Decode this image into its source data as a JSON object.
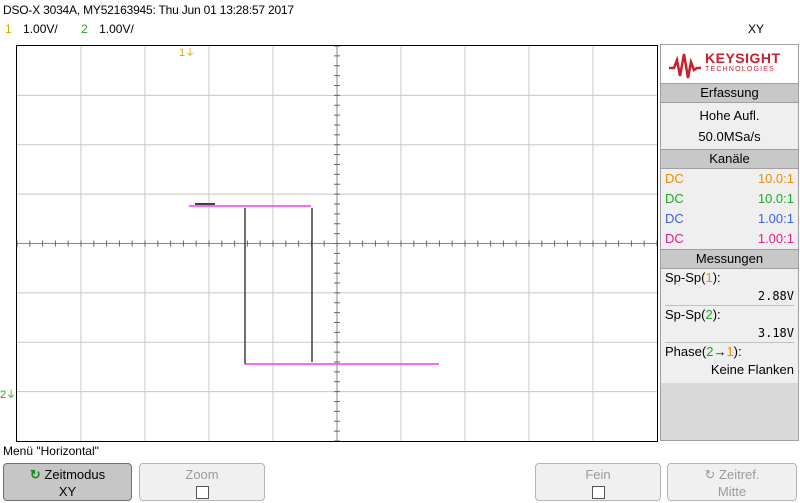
{
  "header": {
    "title": "DSO-X 3034A, MY52163945: Thu Jun 01 13:28:57 2017",
    "mode": "XY",
    "channels": [
      {
        "num": "1",
        "scale": "1.00V/",
        "color": "#e8a000"
      },
      {
        "num": "2",
        "scale": "1.00V/",
        "color": "#1fa81f"
      }
    ]
  },
  "screen": {
    "trace_color": "#ff33ff",
    "grid_color": "#c8c8c8",
    "ch1_marker": "1",
    "ch2_marker": "2"
  },
  "panel": {
    "logo_name": "KEYSIGHT",
    "logo_sub": "TECHNOLOGIES",
    "acq_title": "Erfassung",
    "acq_mode": "Hohe Aufl.",
    "acq_rate": "50.0MSa/s",
    "channels_title": "Kanäle",
    "channels": [
      {
        "coupling": "DC",
        "probe": "10.0:1",
        "color": "#f08c00"
      },
      {
        "coupling": "DC",
        "probe": "10.0:1",
        "color": "#22a822"
      },
      {
        "coupling": "DC",
        "probe": "1.00:1",
        "color": "#4060e0"
      },
      {
        "coupling": "DC",
        "probe": "1.00:1",
        "color": "#e0208c"
      }
    ],
    "meas_title": "Messungen",
    "meas": [
      {
        "label_pre": "Sp-Sp(",
        "src": "1",
        "label_post": "):",
        "value": "2.88V",
        "src_color": "#f08c00"
      },
      {
        "label_pre": "Sp-Sp(",
        "src": "2",
        "label_post": "):",
        "value": "3.18V",
        "src_color": "#22a822"
      }
    ],
    "phase_pre": "Phase(",
    "phase_src1": "2",
    "phase_arrow": "→",
    "phase_src2": "1",
    "phase_post": "):",
    "phase_value": "Keine Flanken"
  },
  "menu": {
    "title": "Menü \"Horizontal\"",
    "softkeys": {
      "zeitmodus_label": "Zeitmodus",
      "zeitmodus_value": "XY",
      "zoom_label": "Zoom",
      "fein_label": "Fein",
      "zeitref_label": "Zeitref.",
      "zeitref_value": "Mitte"
    }
  }
}
